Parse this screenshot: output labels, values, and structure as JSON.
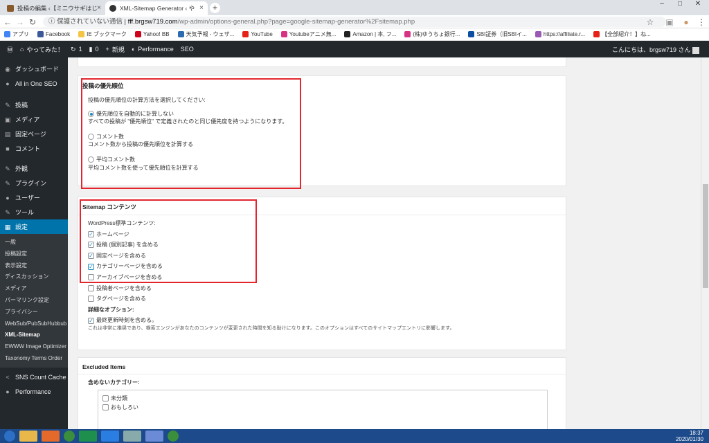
{
  "browser": {
    "tabs": [
      {
        "title": "投稿の編集 ‹【ミニウサギはじ",
        "active": false
      },
      {
        "title": "XML-Sitemap Generator ‹ や",
        "active": true
      }
    ],
    "insecure_label": "保護されていない通信",
    "url_host": "fff.brgsw719.com",
    "url_path": "/wp-admin/options-general.php?page=google-sitemap-generator%2Fsitemap.php",
    "bookmarks": [
      {
        "label": "アプリ",
        "color": "#4285f4"
      },
      {
        "label": "Facebook",
        "color": "#3b5998"
      },
      {
        "label": "IE ブックマーク",
        "color": "#f4c542"
      },
      {
        "label": "Yahoo! BB",
        "color": "#d0021b"
      },
      {
        "label": "天気予報 - ウェザ...",
        "color": "#2b6cb0"
      },
      {
        "label": "YouTube",
        "color": "#e62117"
      },
      {
        "label": "Youtubeアニメ無...",
        "color": "#d63384"
      },
      {
        "label": "Amazon | 本, フ...",
        "color": "#222"
      },
      {
        "label": "(株)ゆうちょ銀行...",
        "color": "#d63384"
      },
      {
        "label": "SBI証券（旧SBIイ...",
        "color": "#0b4ea2"
      },
      {
        "label": "https://affiliate.r...",
        "color": "#9b59b6"
      },
      {
        "label": "【全部紹介！】ね...",
        "color": "#e62117"
      }
    ]
  },
  "adminbar": {
    "site": "やってみた！",
    "updates": "1",
    "comments": "0",
    "new": "新規",
    "performance": "Performance",
    "seo": "SEO",
    "greeting": "こんにちは、brgsw719 さん"
  },
  "sidebar": {
    "items": [
      {
        "label": "ダッシュボード",
        "icon": "dashboard-icon",
        "glyph": "◉"
      },
      {
        "label": "All in One SEO",
        "icon": "seo-icon",
        "glyph": "●"
      },
      {
        "label": "投稿",
        "icon": "pin-icon",
        "glyph": "✎"
      },
      {
        "label": "メディア",
        "icon": "media-icon",
        "glyph": "▣"
      },
      {
        "label": "固定ページ",
        "icon": "page-icon",
        "glyph": "▤"
      },
      {
        "label": "コメント",
        "icon": "comment-icon",
        "glyph": "■"
      },
      {
        "label": "外観",
        "icon": "appearance-icon",
        "glyph": "✎"
      },
      {
        "label": "プラグイン",
        "icon": "plugin-icon",
        "glyph": "✎"
      },
      {
        "label": "ユーザー",
        "icon": "user-icon",
        "glyph": "●"
      },
      {
        "label": "ツール",
        "icon": "tool-icon",
        "glyph": "✎"
      },
      {
        "label": "設定",
        "icon": "settings-icon",
        "glyph": "▦"
      }
    ],
    "submenu": [
      "一般",
      "投稿設定",
      "表示設定",
      "ディスカッション",
      "メディア",
      "パーマリンク設定",
      "プライバシー",
      "WebSub/PubSubHubbub",
      "XML-Sitemap",
      "EWWW Image Optimizer",
      "Taxonomy Terms Order"
    ],
    "bottom": [
      {
        "label": "SNS Count Cache",
        "icon": "share-icon",
        "glyph": "<"
      },
      {
        "label": "Performance",
        "icon": "performance-icon",
        "glyph": "●"
      }
    ]
  },
  "priority": {
    "title": "投稿の優先順位",
    "intro": "投稿の優先順位の計算方法を選択してください:",
    "options": [
      {
        "label": "優先順位を自動的に計算しない",
        "desc": "すべての投稿が \"優先順位\" で定義されたのと同じ優先度を持つようになります。",
        "checked": true
      },
      {
        "label": "コメント数",
        "desc": "コメント数から投稿の優先順位を計算する",
        "checked": false
      },
      {
        "label": "平均コメント数",
        "desc": "平均コメント数を使って優先順位を計算する",
        "checked": false
      }
    ]
  },
  "content": {
    "title": "Sitemap コンテンツ",
    "wp_label": "WordPress標準コンテンツ:",
    "items": [
      {
        "label": "ホームページ",
        "checked": true
      },
      {
        "label": "投稿 (個別記事) を含める",
        "checked": true
      },
      {
        "label": "固定ページを含める",
        "checked": true
      },
      {
        "label": "カテゴリーページを含める",
        "checked": true
      },
      {
        "label": "アーカイブページを含める",
        "checked": false
      },
      {
        "label": "投稿者ページを含める",
        "checked": false
      },
      {
        "label": "タグページを含める",
        "checked": false
      }
    ],
    "advanced_label": "詳細なオプション:",
    "lastmod_label": "最終更新時刻を含める。",
    "lastmod_checked": true,
    "lastmod_note": "これは非常に推奨であり、検索エンジンがあなたのコンテンツが変更された時間を知る助けになります。このオプションはすべてのサイトマップエントリに影響します。"
  },
  "excluded": {
    "title": "Excluded Items",
    "categories_label": "含めないカテゴリー:",
    "categories": [
      "未分類",
      "おもしろい"
    ]
  },
  "taskbar": {
    "time": "18:37",
    "date": "2020/01/30"
  }
}
